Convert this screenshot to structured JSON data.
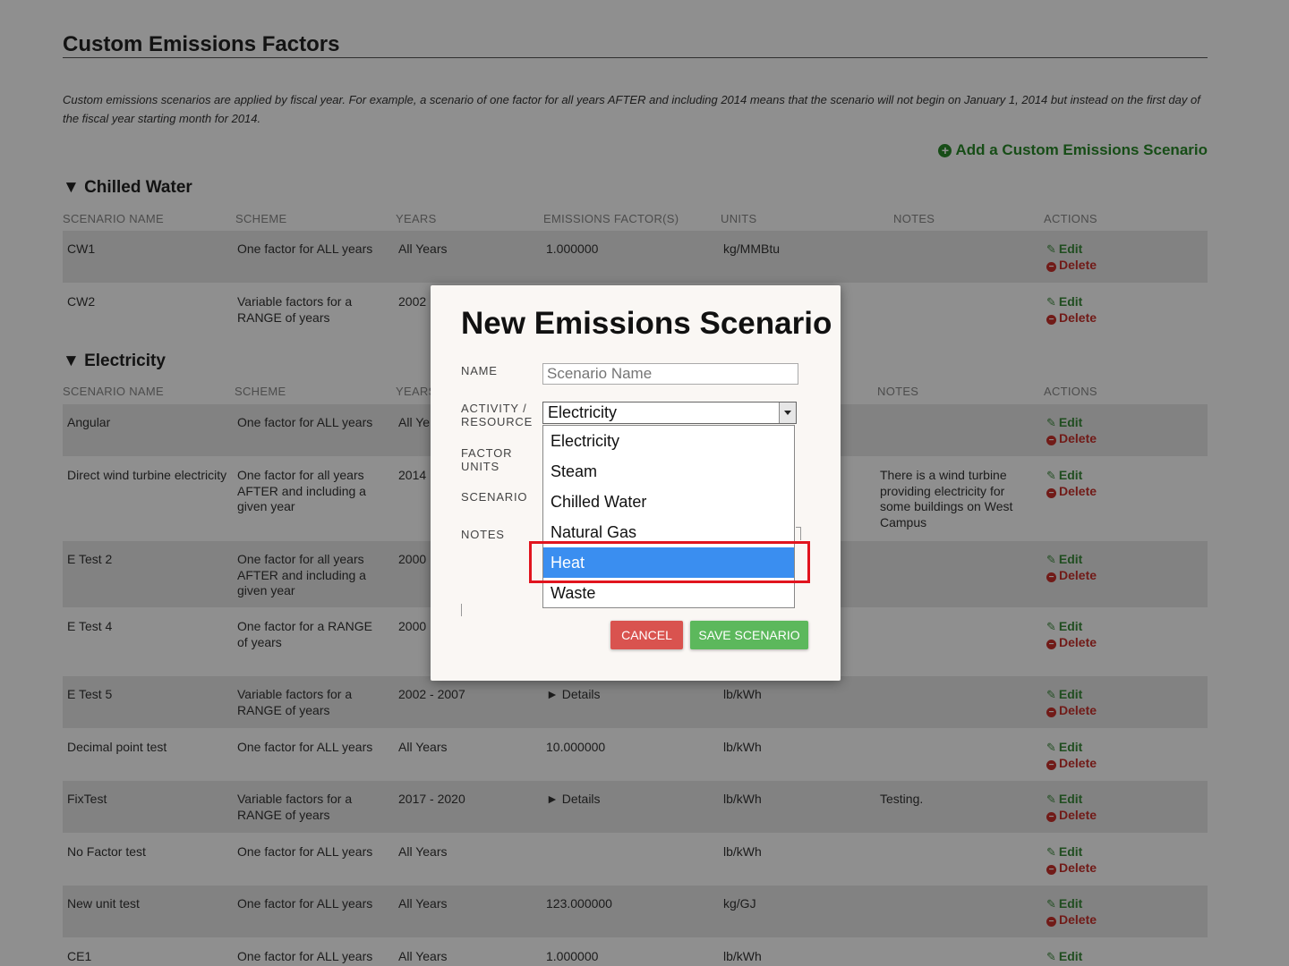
{
  "page": {
    "title": "Custom Emissions Factors",
    "intro": "Custom emissions scenarios are applied by fiscal year. For example, a scenario of one factor for all years AFTER and including 2014 means that the scenario will not begin on January 1, 2014 but instead on the first day of the fiscal year starting month for 2014.",
    "add_link": "Add a Custom Emissions Scenario",
    "add_icon": "+"
  },
  "columns": [
    "SCENARIO NAME",
    "SCHEME",
    "YEARS",
    "EMISSIONS FACTOR(S)",
    "UNITS",
    "NOTES",
    "ACTIONS"
  ],
  "actions": {
    "edit": "Edit",
    "delete": "Delete",
    "edit_icon": "✎",
    "delete_icon": "−"
  },
  "sections": [
    {
      "title": "▼ Chilled Water",
      "rows": [
        {
          "name": "CW1",
          "scheme": "One factor for ALL years",
          "years": "All Years",
          "factor": "1.000000",
          "units": "kg/MMBtu",
          "notes": ""
        },
        {
          "name": "CW2",
          "scheme": "Variable factors for a RANGE of years",
          "years": "2002",
          "factor": "",
          "units": "",
          "notes": ""
        }
      ]
    },
    {
      "title": "▼ Electricity",
      "rows": [
        {
          "name": "Angular",
          "scheme": "One factor for ALL years",
          "years": "All Ye",
          "factor": "",
          "units": "",
          "notes": ""
        },
        {
          "name": "Direct wind turbine electricity",
          "scheme": "One factor for all years AFTER and including a given year",
          "years": "2014",
          "factor": "",
          "units": "",
          "notes": "There is a wind turbine providing electricity for some buildings on West Campus"
        },
        {
          "name": "E Test 2",
          "scheme": "One factor for all years AFTER and including a given year",
          "years": "2000",
          "factor": "",
          "units": "",
          "notes": ""
        },
        {
          "name": "E Test 4",
          "scheme": "One factor for a RANGE of years",
          "years": "2000",
          "factor": "",
          "units": "",
          "notes": ""
        },
        {
          "name": "E Test 5",
          "scheme": "Variable factors for a RANGE of years",
          "years": "2002 - 2007",
          "factor": "► Details",
          "units": "lb/kWh",
          "notes": ""
        },
        {
          "name": "Decimal point test",
          "scheme": "One factor for ALL years",
          "years": "All Years",
          "factor": "10.000000",
          "units": "lb/kWh",
          "notes": ""
        },
        {
          "name": "FixTest",
          "scheme": "Variable factors for a RANGE of years",
          "years": "2017 - 2020",
          "factor": "► Details",
          "units": "lb/kWh",
          "notes": "Testing."
        },
        {
          "name": "No Factor test",
          "scheme": "One factor for ALL years",
          "years": "All Years",
          "factor": "",
          "units": "lb/kWh",
          "notes": ""
        },
        {
          "name": "New unit test",
          "scheme": "One factor for ALL years",
          "years": "All Years",
          "factor": "123.000000",
          "units": "kg/GJ",
          "notes": ""
        },
        {
          "name": "CE1",
          "scheme": "One factor for ALL years",
          "years": "All Years",
          "factor": "1.000000",
          "units": "lb/kWh",
          "notes": ""
        }
      ]
    }
  ],
  "modal": {
    "title": "New Emissions Scenario",
    "labels": {
      "name": "NAME",
      "activity_1": "ACTIVITY /",
      "activity_2": "RESOURCE",
      "factor_1": "FACTOR",
      "factor_2": "UNITS",
      "scenario": "SCENARIO",
      "notes": "NOTES"
    },
    "name_placeholder": "Scenario Name",
    "activity_selected": "Electricity",
    "activity_options": [
      "Electricity",
      "Steam",
      "Chilled Water",
      "Natural Gas",
      "Heat",
      "Waste"
    ],
    "highlighted_option": "Heat",
    "cancel": "CANCEL",
    "save": "SAVE SCENARIO"
  },
  "colors": {
    "overlay": "#000000",
    "edit": "#3a8a3a",
    "delete": "#c9302c",
    "add_link": "#2a8a2a",
    "cancel_button": "#d9534f",
    "save_button": "#5cb85c",
    "option_selected": "#3a8ef0",
    "highlight_box": "#e1141e"
  }
}
